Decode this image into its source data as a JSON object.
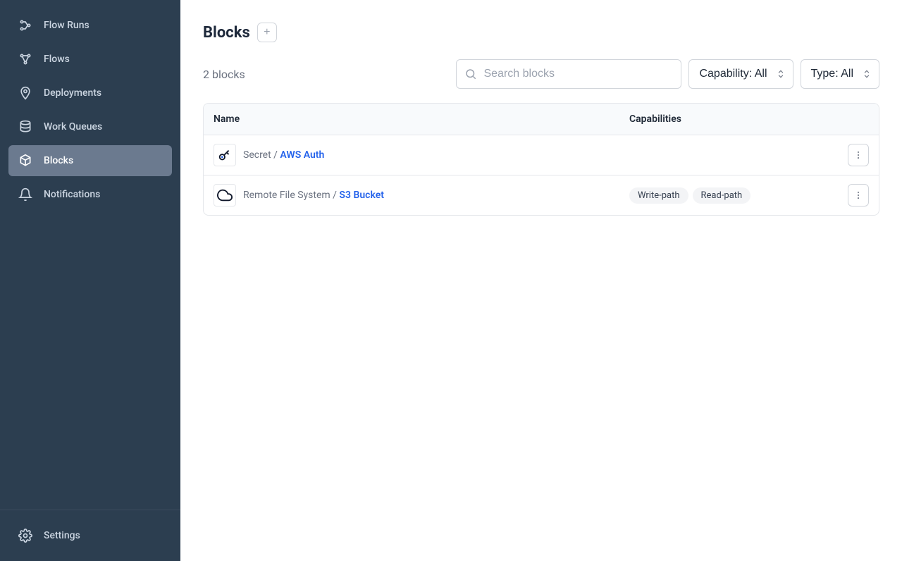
{
  "sidebar": {
    "items": [
      {
        "label": "Flow Runs"
      },
      {
        "label": "Flows"
      },
      {
        "label": "Deployments"
      },
      {
        "label": "Work Queues"
      },
      {
        "label": "Blocks"
      },
      {
        "label": "Notifications"
      }
    ],
    "settings_label": "Settings"
  },
  "page": {
    "title": "Blocks",
    "count_text": "2 blocks",
    "search_placeholder": "Search blocks",
    "capability_filter": "Capability: All",
    "type_filter": "Type: All"
  },
  "table": {
    "headers": {
      "name": "Name",
      "capabilities": "Capabilities"
    },
    "rows": [
      {
        "type": "Secret",
        "separator": " / ",
        "name": "AWS Auth",
        "capabilities": []
      },
      {
        "type": "Remote File System",
        "separator": " / ",
        "name": "S3 Bucket",
        "capabilities": [
          "Write-path",
          "Read-path"
        ]
      }
    ]
  }
}
